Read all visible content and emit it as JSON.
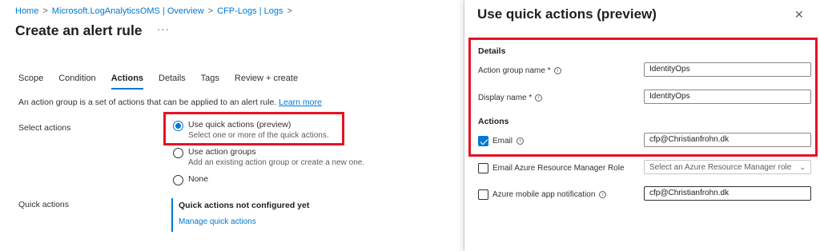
{
  "breadcrumb": {
    "items": [
      "Home",
      "Microsoft.LogAnalyticsOMS | Overview",
      "CFP-Logs | Logs"
    ],
    "separator": ">"
  },
  "page": {
    "title": "Create an alert rule",
    "more": "···"
  },
  "tabs": [
    {
      "label": "Scope"
    },
    {
      "label": "Condition"
    },
    {
      "label": "Actions",
      "active": true
    },
    {
      "label": "Details"
    },
    {
      "label": "Tags"
    },
    {
      "label": "Review + create"
    }
  ],
  "description": {
    "text": "An action group is a set of actions that can be applied to an alert rule.",
    "link": "Learn more"
  },
  "select_actions": {
    "label": "Select actions",
    "options": [
      {
        "title": "Use quick actions (preview)",
        "sub": "Select one or more of the quick actions.",
        "checked": true
      },
      {
        "title": "Use action groups",
        "sub": "Add an existing action group or create a new one.",
        "checked": false
      },
      {
        "title": "None",
        "sub": "",
        "checked": false
      }
    ]
  },
  "quick_actions": {
    "label": "Quick actions",
    "status": "Quick actions not configured yet",
    "link": "Manage quick actions"
  },
  "panel": {
    "title": "Use quick actions (preview)",
    "close": "✕",
    "details_heading": "Details",
    "action_group_name": {
      "label": "Action group name *",
      "value": "IdentityOps"
    },
    "display_name": {
      "label": "Display name *",
      "value": "IdentityOps"
    },
    "actions_heading": "Actions",
    "email": {
      "label": "Email",
      "checked": true,
      "value": "cfp@Christianfrohn.dk"
    },
    "email_arm_role": {
      "label": "Email Azure Resource Manager Role",
      "checked": false,
      "placeholder": "Select an Azure Resource Manager role"
    },
    "mobile_app": {
      "label": "Azure mobile app notification",
      "checked": false,
      "value": "cfp@Christianfrohn.dk"
    }
  },
  "colors": {
    "accent": "#0078d4",
    "highlight": "#e81123"
  }
}
